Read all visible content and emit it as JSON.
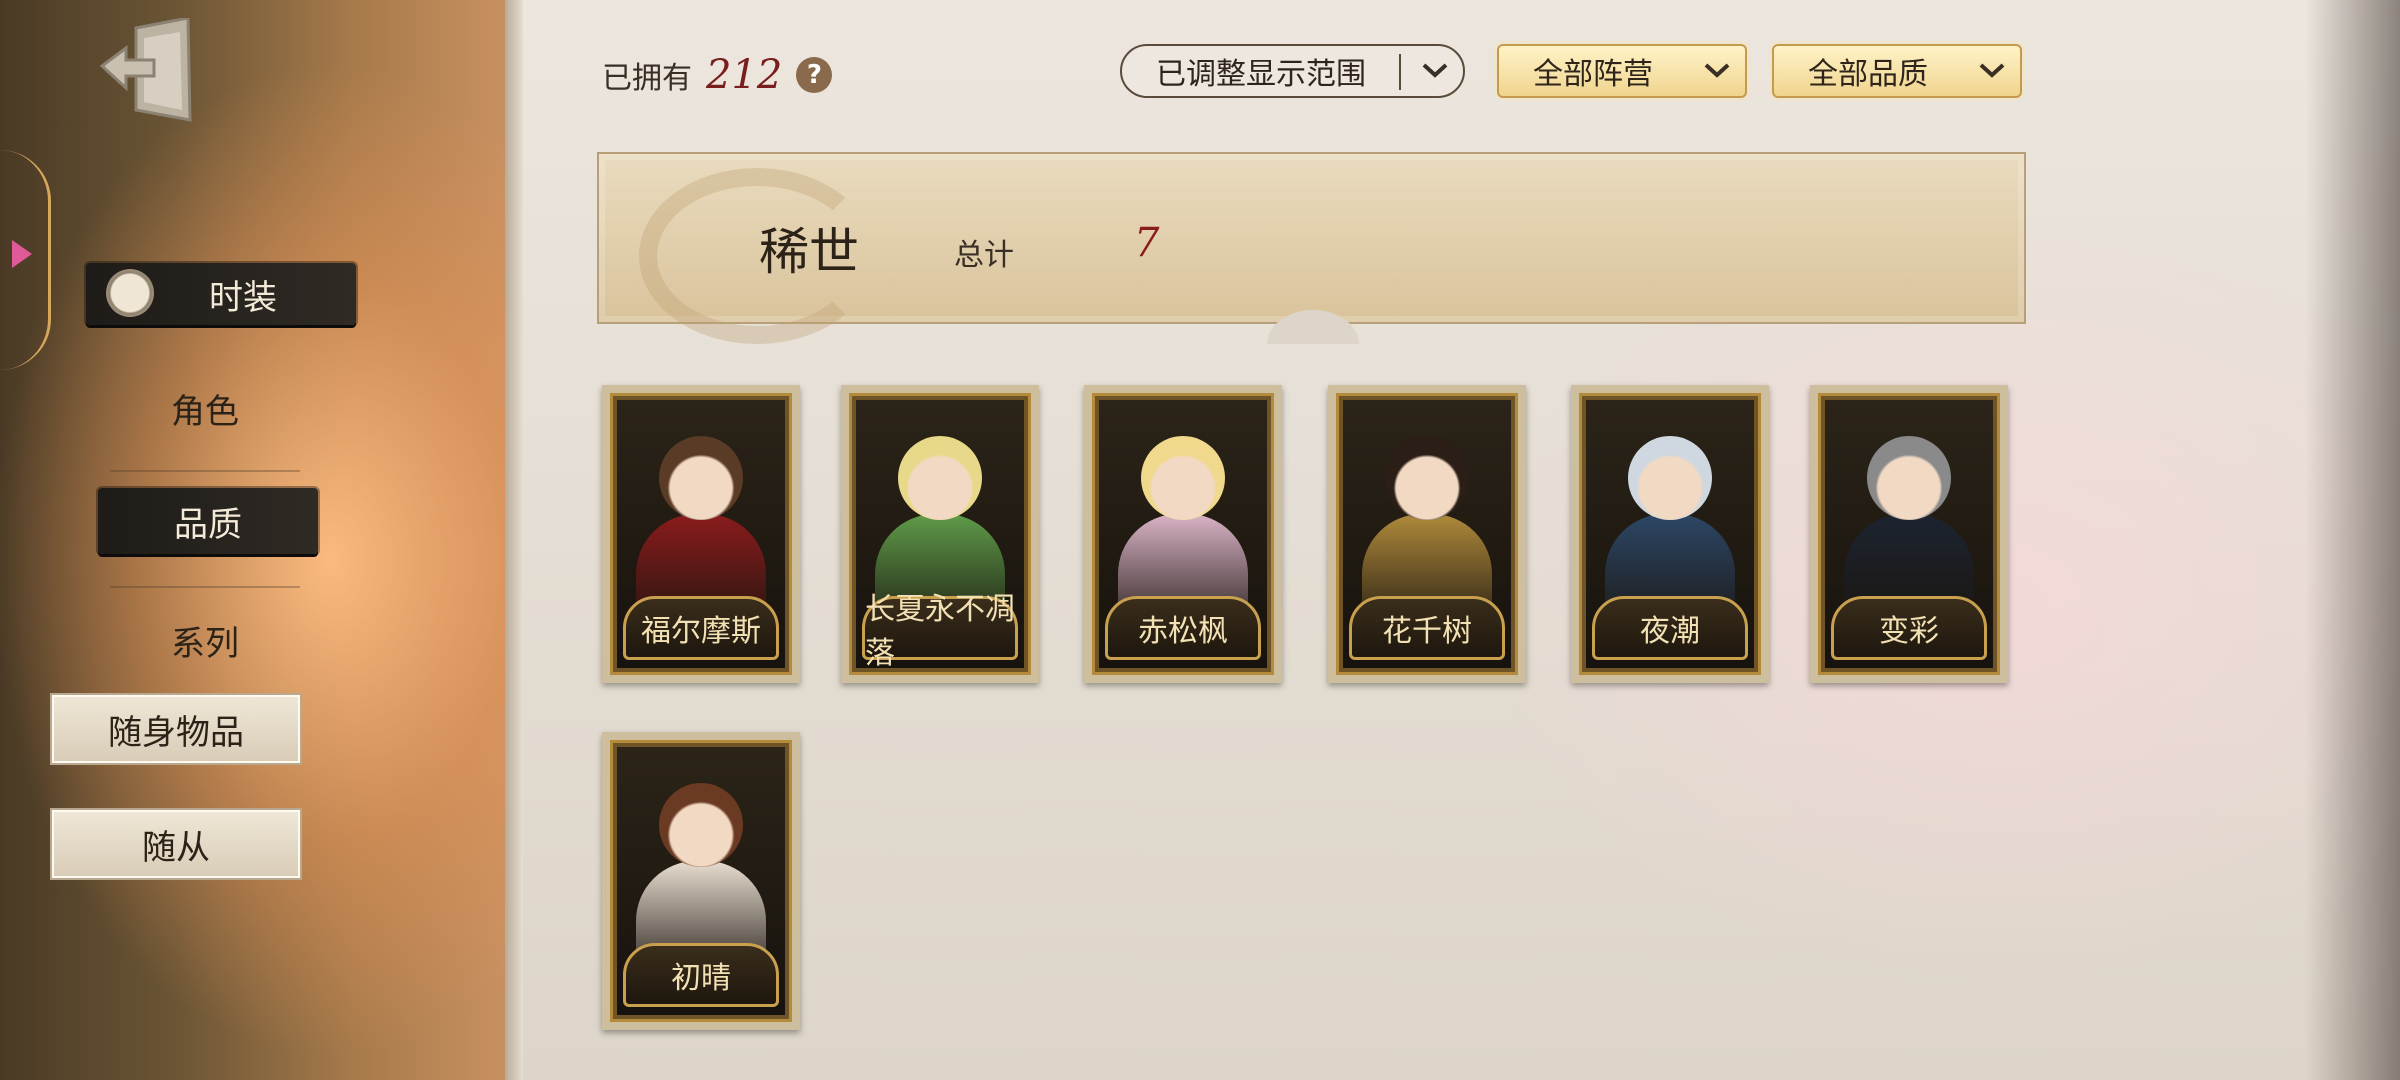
{
  "sidebar": {
    "items": [
      {
        "label": "时装",
        "state": "active"
      },
      {
        "label": "角色",
        "state": "normal"
      },
      {
        "label": "品质",
        "state": "selected"
      },
      {
        "label": "系列",
        "state": "normal"
      },
      {
        "label": "随身物品",
        "state": "paper"
      },
      {
        "label": "随从",
        "state": "paper"
      }
    ]
  },
  "header": {
    "owned_label": "已拥有",
    "owned_count": "212",
    "help_icon": "?",
    "filters": {
      "range": "已调整显示范围",
      "camp": "全部阵营",
      "quality": "全部品质"
    }
  },
  "section": {
    "title": "稀世",
    "total_label": "总计",
    "total_count": "7"
  },
  "cards": [
    {
      "name": "福尔摩斯",
      "hair": "#5a3b26",
      "outfit": "#8b1c1c"
    },
    {
      "name": "长夏永不凋落",
      "hair": "#e8d98a",
      "outfit": "#5f9b4a"
    },
    {
      "name": "赤松枫",
      "hair": "#f0d98c",
      "outfit": "#d9b3c6"
    },
    {
      "name": "花千树",
      "hair": "#2a1e16",
      "outfit": "#b08a3c"
    },
    {
      "name": "夜潮",
      "hair": "#cfd8e0",
      "outfit": "#2d4766"
    },
    {
      "name": "变彩",
      "hair": "#8a8a8a",
      "outfit": "#1d2430"
    },
    {
      "name": "初晴",
      "hair": "#6a3a22",
      "outfit": "#e8ddd0"
    }
  ],
  "colors": {
    "accent_red": "#8a1c1c",
    "gold": "#c9a04e"
  }
}
